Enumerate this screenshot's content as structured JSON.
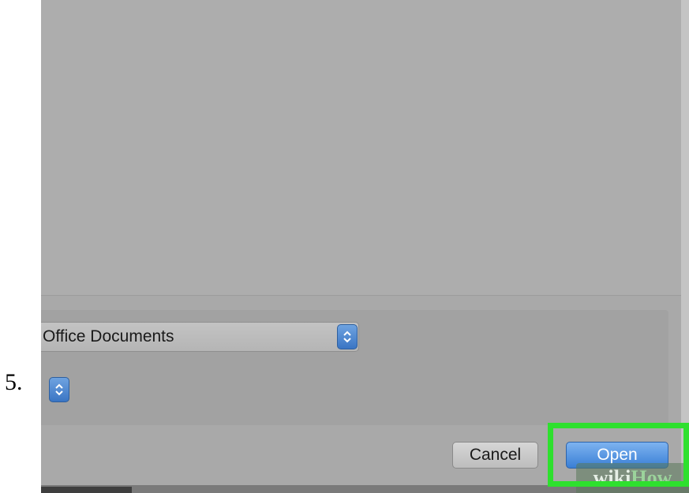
{
  "step_number": "5.",
  "dialog": {
    "file_type_popup": {
      "selected": "Office Documents"
    },
    "buttons": {
      "cancel_label": "Cancel",
      "open_label": "Open"
    }
  },
  "watermark": {
    "part1": "wiki",
    "part2": "How"
  },
  "icons": {
    "popup_arrows": "updown-chevron-icon"
  },
  "colors": {
    "highlight": "#2ee02e",
    "primary_button": "#3a7fd5",
    "panel_background": "#a9a9a9"
  }
}
